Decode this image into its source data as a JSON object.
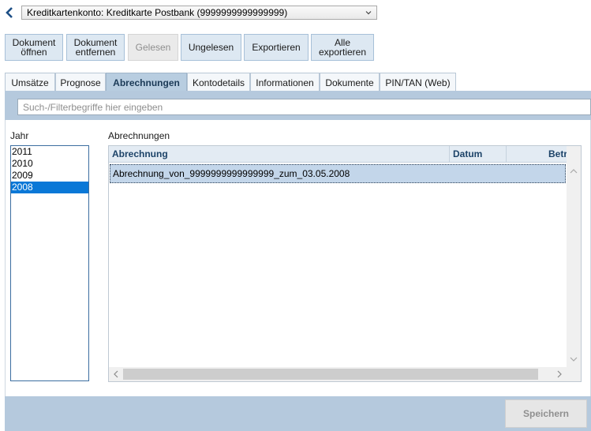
{
  "account_select": {
    "value": "Kreditkartenkonto: Kreditkarte Postbank (9999999999999999)"
  },
  "toolbar": {
    "open_document": "Dokument\nöffnen",
    "remove_document": "Dokument\nentfernen",
    "read": "Gelesen",
    "unread": "Ungelesen",
    "export": "Exportieren",
    "export_all": "Alle\nexportieren"
  },
  "tabs": [
    {
      "label": "Umsätze"
    },
    {
      "label": "Prognose"
    },
    {
      "label": "Abrechnungen"
    },
    {
      "label": "Kontodetails"
    },
    {
      "label": "Informationen"
    },
    {
      "label": "Dokumente"
    },
    {
      "label": "PIN/TAN (Web)"
    }
  ],
  "active_tab": "Abrechnungen",
  "filter": {
    "placeholder": "Such-/Filterbegriffe hier eingeben"
  },
  "years": {
    "label": "Jahr",
    "items": [
      "2011",
      "2010",
      "2009",
      "2008"
    ],
    "selected": "2008"
  },
  "statements": {
    "label": "Abrechnungen",
    "columns": [
      "Abrechnung",
      "Datum",
      "Betr"
    ],
    "rows": [
      {
        "name": "Abrechnung_von_9999999999999999_zum_03.05.2008"
      }
    ]
  },
  "footer": {
    "save_label": "Speichern"
  },
  "colors": {
    "accent": "#0a78d7",
    "band": "#b5c9dd",
    "tab_active": "#b8cde0"
  }
}
